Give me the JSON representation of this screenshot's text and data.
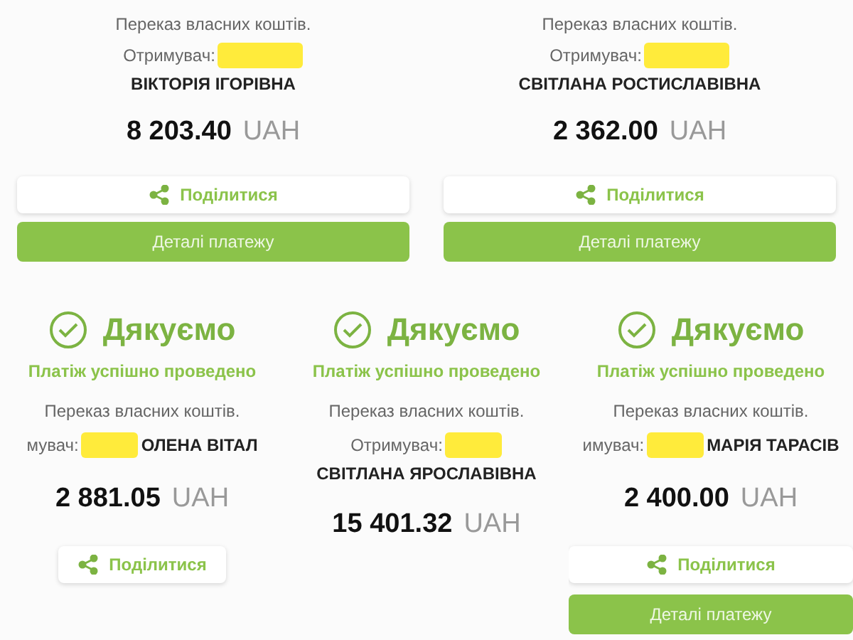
{
  "receipts": [
    {
      "description": "Переказ власних коштів.",
      "recipient_label": "Отримувач:",
      "recipient_name": "ВІКТОРІЯ ІГОРІВНА",
      "amount": "8 203.40",
      "currency": "UAH",
      "share": "Поділитися",
      "details": "Деталі платежу"
    },
    {
      "description": "Переказ власних коштів.",
      "recipient_label": "Отримувач:",
      "recipient_name": "СВІТЛАНА РОСТИСЛАВІВНА",
      "amount": "2 362.00",
      "currency": "UAH",
      "share": "Поділитися",
      "details": "Деталі платежу"
    },
    {
      "thanks": "Дякуємо",
      "status": "Платіж успішно проведено",
      "description": "Переказ власних коштів.",
      "recipient_label": "мувач:",
      "recipient_name": "ОЛЕНА ВІТАЛ",
      "amount": "2 881.05",
      "currency": "UAH",
      "share": "Поділитися"
    },
    {
      "thanks": "Дякуємо",
      "status": "Платіж успішно проведено",
      "description": "Переказ власних коштів.",
      "recipient_label": "Отримувач:",
      "recipient_name": "СВІТЛАНА ЯРОСЛАВІВНА",
      "amount": "15 401.32",
      "currency": "UAH"
    },
    {
      "thanks": "Дякуємо",
      "status": "Платіж успішно проведено",
      "description": "Переказ власних коштів.",
      "recipient_label": "имувач:",
      "recipient_name": "МАРІЯ ТАРАСІВ",
      "amount": "2 400.00",
      "currency": "UAH",
      "share": "Поділитися",
      "details": "Деталі платежу"
    }
  ]
}
